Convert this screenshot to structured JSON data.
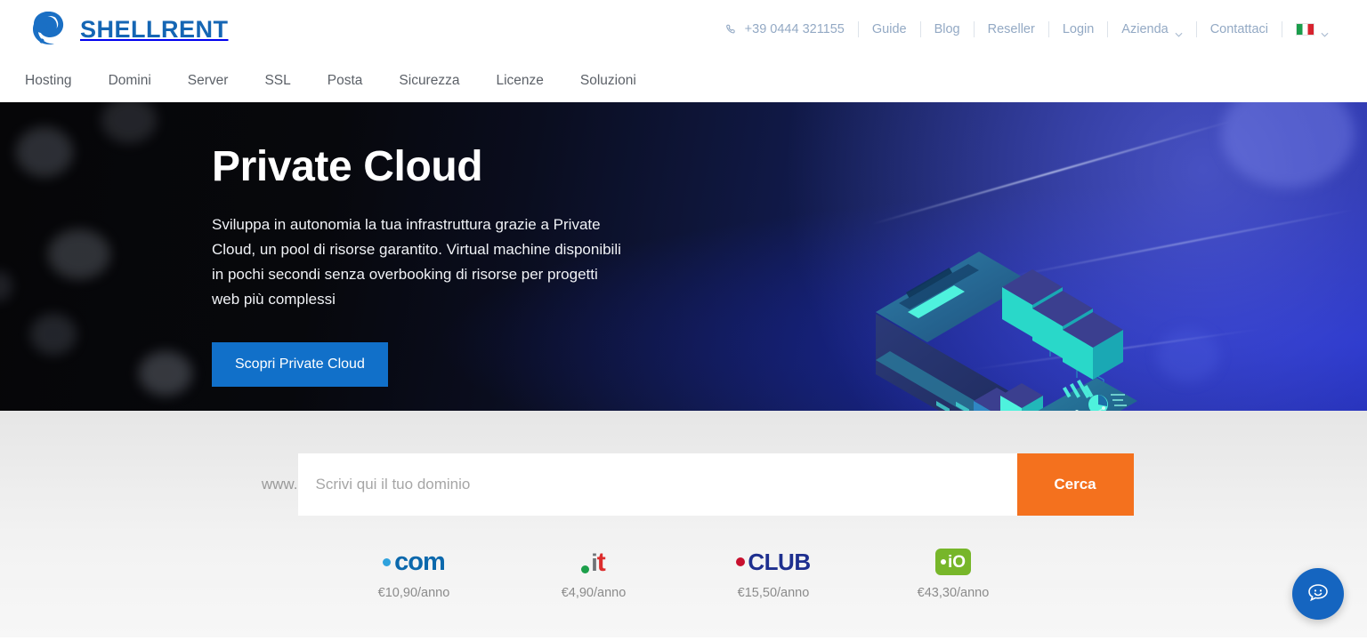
{
  "header": {
    "logo": {
      "text": "SHELLRENT",
      "icon": "shell-swirl-icon"
    },
    "utility_nav": {
      "phone": "+39 0444 321155",
      "phone_icon": "phone-icon",
      "items": [
        {
          "label": "Guide",
          "dropdown": false
        },
        {
          "label": "Blog",
          "dropdown": false
        },
        {
          "label": "Reseller",
          "dropdown": false
        },
        {
          "label": "Login",
          "dropdown": false
        },
        {
          "label": "Azienda",
          "dropdown": true
        },
        {
          "label": "Contattaci",
          "dropdown": false
        }
      ],
      "language": {
        "flag": "italy-flag-icon",
        "dropdown": true
      }
    },
    "main_nav": [
      {
        "label": "Hosting"
      },
      {
        "label": "Domini"
      },
      {
        "label": "Server"
      },
      {
        "label": "SSL"
      },
      {
        "label": "Posta"
      },
      {
        "label": "Sicurezza"
      },
      {
        "label": "Licenze"
      },
      {
        "label": "Soluzioni"
      }
    ]
  },
  "hero": {
    "title": "Private Cloud",
    "subtitle": "Sviluppa in autonomia la tua infrastruttura grazie a Private Cloud, un pool di risorse garantito. Virtual machine disponibili in pochi secondi senza overbooking di risorse per progetti web più complessi",
    "cta_label": "Scopri Private Cloud",
    "cta_color": "#1170c9",
    "illustration": "isometric-cloud-servers-illustration"
  },
  "domain_search": {
    "prefix_label": "www.",
    "placeholder": "Scrivi qui il tuo dominio",
    "value": "",
    "button_label": "Cerca",
    "button_color": "#f4711e",
    "tlds": [
      {
        "name": ".com",
        "price": "€10,90/anno",
        "color": "#0b68ac"
      },
      {
        "name": ".it",
        "price": "€4,90/anno",
        "color": "#dc2c2c"
      },
      {
        "name": ".CLUB",
        "price": "€15,50/anno",
        "color": "#1e2f8f"
      },
      {
        "name": ".io",
        "price": "€43,30/anno",
        "color": "#77b62a"
      }
    ]
  },
  "chat_widget": {
    "icon": "chat-smiley-icon",
    "color": "#1565c0"
  }
}
